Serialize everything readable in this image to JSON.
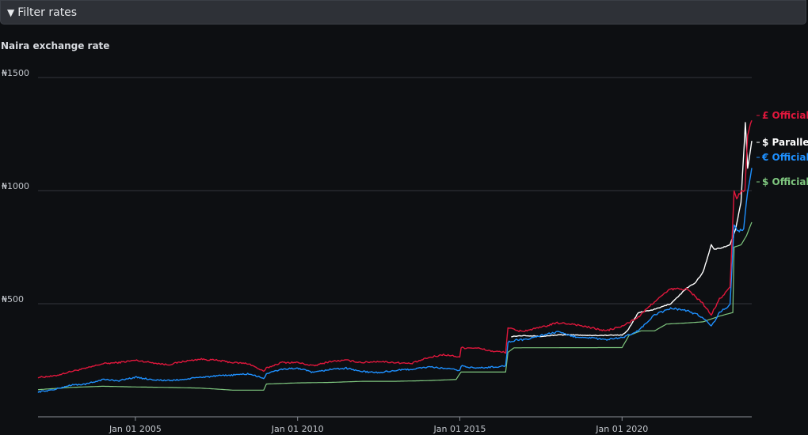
{
  "filter": {
    "label": "Filter rates",
    "icon": "caret-down-icon"
  },
  "chart_data": {
    "type": "line",
    "title": "Naira exchange rate",
    "xlabel": "",
    "ylabel": "",
    "ylim": [
      0,
      1500
    ],
    "y_ticks": [
      {
        "value": 500,
        "label": "₦500"
      },
      {
        "value": 1000,
        "label": "₦1000"
      },
      {
        "value": 1500,
        "label": "₦1500"
      }
    ],
    "x_range": [
      "2002-01-01",
      "2023-12-31"
    ],
    "x_ticks": [
      {
        "value": "2005-01-01",
        "label": "Jan 01 2005"
      },
      {
        "value": "2010-01-01",
        "label": "Jan 01 2010"
      },
      {
        "value": "2015-01-01",
        "label": "Jan 01 2015"
      },
      {
        "value": "2020-01-01",
        "label": "Jan 01 2020"
      }
    ],
    "grid": true,
    "legend": "right (end-of-line labels)",
    "series": [
      {
        "name": "£ Official",
        "color": "#e0173c",
        "points": [
          [
            "2002-01-01",
            175
          ],
          [
            "2002-07-01",
            180
          ],
          [
            "2003-01-01",
            200
          ],
          [
            "2003-07-01",
            215
          ],
          [
            "2004-01-01",
            235
          ],
          [
            "2004-07-01",
            240
          ],
          [
            "2005-01-01",
            250
          ],
          [
            "2005-07-01",
            240
          ],
          [
            "2006-01-01",
            230
          ],
          [
            "2006-07-01",
            245
          ],
          [
            "2007-01-01",
            255
          ],
          [
            "2007-07-01",
            250
          ],
          [
            "2008-01-01",
            240
          ],
          [
            "2008-07-01",
            235
          ],
          [
            "2008-12-15",
            200
          ],
          [
            "2009-01-15",
            215
          ],
          [
            "2009-07-01",
            240
          ],
          [
            "2010-01-01",
            240
          ],
          [
            "2010-07-01",
            225
          ],
          [
            "2011-01-01",
            245
          ],
          [
            "2011-07-01",
            250
          ],
          [
            "2012-01-01",
            240
          ],
          [
            "2012-07-01",
            245
          ],
          [
            "2013-01-01",
            240
          ],
          [
            "2013-07-01",
            235
          ],
          [
            "2014-01-01",
            260
          ],
          [
            "2014-07-01",
            275
          ],
          [
            "2014-12-31",
            265
          ],
          [
            "2015-01-15",
            305
          ],
          [
            "2015-07-01",
            305
          ],
          [
            "2016-01-01",
            290
          ],
          [
            "2016-05-31",
            285
          ],
          [
            "2016-06-25",
            395
          ],
          [
            "2016-10-01",
            380
          ],
          [
            "2017-01-01",
            380
          ],
          [
            "2017-07-01",
            395
          ],
          [
            "2018-01-01",
            415
          ],
          [
            "2018-07-01",
            410
          ],
          [
            "2019-01-01",
            395
          ],
          [
            "2019-07-01",
            380
          ],
          [
            "2019-10-01",
            390
          ],
          [
            "2020-01-01",
            400
          ],
          [
            "2020-07-01",
            440
          ],
          [
            "2021-01-01",
            510
          ],
          [
            "2021-07-01",
            565
          ],
          [
            "2022-01-01",
            565
          ],
          [
            "2022-07-01",
            500
          ],
          [
            "2022-10-01",
            450
          ],
          [
            "2023-01-01",
            520
          ],
          [
            "2023-05-01",
            570
          ],
          [
            "2023-06-15",
            1000
          ],
          [
            "2023-07-15",
            960
          ],
          [
            "2023-09-01",
            1000
          ],
          [
            "2023-10-15",
            1000
          ],
          [
            "2023-11-15",
            1250
          ],
          [
            "2023-12-31",
            1310
          ]
        ]
      },
      {
        "name": "$ Parallel",
        "color": "#ffffff",
        "points": [
          [
            "2016-08-01",
            355
          ],
          [
            "2017-01-01",
            360
          ],
          [
            "2017-07-01",
            355
          ],
          [
            "2018-01-01",
            362
          ],
          [
            "2018-07-01",
            362
          ],
          [
            "2019-01-01",
            360
          ],
          [
            "2019-07-01",
            360
          ],
          [
            "2020-01-01",
            362
          ],
          [
            "2020-03-01",
            380
          ],
          [
            "2020-07-01",
            460
          ],
          [
            "2021-01-01",
            475
          ],
          [
            "2021-07-01",
            500
          ],
          [
            "2022-01-01",
            570
          ],
          [
            "2022-04-01",
            590
          ],
          [
            "2022-07-01",
            640
          ],
          [
            "2022-10-01",
            760
          ],
          [
            "2022-11-01",
            740
          ],
          [
            "2023-01-01",
            745
          ],
          [
            "2023-05-01",
            760
          ],
          [
            "2023-07-01",
            830
          ],
          [
            "2023-09-01",
            950
          ],
          [
            "2023-10-20",
            1300
          ],
          [
            "2023-11-15",
            1100
          ],
          [
            "2023-12-31",
            1220
          ]
        ]
      },
      {
        "name": "€ Official",
        "color": "#1e90ff",
        "points": [
          [
            "2002-01-01",
            110
          ],
          [
            "2002-07-01",
            120
          ],
          [
            "2003-01-01",
            140
          ],
          [
            "2003-07-01",
            145
          ],
          [
            "2004-01-01",
            165
          ],
          [
            "2004-07-01",
            160
          ],
          [
            "2005-01-01",
            175
          ],
          [
            "2005-07-01",
            165
          ],
          [
            "2006-01-01",
            160
          ],
          [
            "2006-07-01",
            165
          ],
          [
            "2007-01-01",
            175
          ],
          [
            "2007-07-01",
            180
          ],
          [
            "2008-01-01",
            185
          ],
          [
            "2008-07-01",
            190
          ],
          [
            "2008-12-15",
            170
          ],
          [
            "2009-01-15",
            190
          ],
          [
            "2009-07-01",
            210
          ],
          [
            "2010-01-01",
            215
          ],
          [
            "2010-07-01",
            195
          ],
          [
            "2011-01-01",
            210
          ],
          [
            "2011-07-01",
            215
          ],
          [
            "2012-01-01",
            200
          ],
          [
            "2012-07-01",
            195
          ],
          [
            "2013-01-01",
            205
          ],
          [
            "2013-07-01",
            210
          ],
          [
            "2014-01-01",
            220
          ],
          [
            "2014-07-01",
            215
          ],
          [
            "2014-12-31",
            205
          ],
          [
            "2015-01-15",
            225
          ],
          [
            "2015-07-01",
            215
          ],
          [
            "2016-01-01",
            220
          ],
          [
            "2016-05-31",
            225
          ],
          [
            "2016-06-25",
            330
          ],
          [
            "2016-10-01",
            340
          ],
          [
            "2017-01-01",
            340
          ],
          [
            "2017-07-01",
            360
          ],
          [
            "2018-01-01",
            375
          ],
          [
            "2018-07-01",
            355
          ],
          [
            "2019-01-01",
            350
          ],
          [
            "2019-07-01",
            340
          ],
          [
            "2020-01-01",
            350
          ],
          [
            "2020-07-01",
            380
          ],
          [
            "2021-01-01",
            450
          ],
          [
            "2021-07-01",
            480
          ],
          [
            "2022-01-01",
            470
          ],
          [
            "2022-07-01",
            440
          ],
          [
            "2022-10-01",
            400
          ],
          [
            "2023-01-01",
            460
          ],
          [
            "2023-05-01",
            495
          ],
          [
            "2023-06-15",
            850
          ],
          [
            "2023-08-01",
            820
          ],
          [
            "2023-10-01",
            830
          ],
          [
            "2023-11-15",
            1000
          ],
          [
            "2023-12-31",
            1100
          ]
        ]
      },
      {
        "name": "$ Official",
        "color": "#7fc77f",
        "points": [
          [
            "2002-01-01",
            120
          ],
          [
            "2003-01-01",
            130
          ],
          [
            "2004-01-01",
            135
          ],
          [
            "2005-01-01",
            132
          ],
          [
            "2006-01-01",
            130
          ],
          [
            "2007-01-01",
            127
          ],
          [
            "2008-01-01",
            118
          ],
          [
            "2008-12-15",
            118
          ],
          [
            "2009-01-15",
            145
          ],
          [
            "2010-01-01",
            150
          ],
          [
            "2011-01-01",
            152
          ],
          [
            "2012-01-01",
            157
          ],
          [
            "2013-01-01",
            157
          ],
          [
            "2014-01-01",
            160
          ],
          [
            "2014-11-20",
            165
          ],
          [
            "2014-12-31",
            190
          ],
          [
            "2015-01-15",
            198
          ],
          [
            "2016-05-31",
            198
          ],
          [
            "2016-06-25",
            285
          ],
          [
            "2016-09-01",
            305
          ],
          [
            "2020-01-01",
            306
          ],
          [
            "2020-03-20",
            360
          ],
          [
            "2020-08-01",
            380
          ],
          [
            "2021-01-01",
            380
          ],
          [
            "2021-05-15",
            410
          ],
          [
            "2022-01-01",
            415
          ],
          [
            "2022-07-01",
            420
          ],
          [
            "2023-01-01",
            445
          ],
          [
            "2023-06-01",
            461
          ],
          [
            "2023-06-15",
            750
          ],
          [
            "2023-09-01",
            760
          ],
          [
            "2023-11-01",
            800
          ],
          [
            "2023-12-31",
            860
          ]
        ]
      }
    ]
  }
}
